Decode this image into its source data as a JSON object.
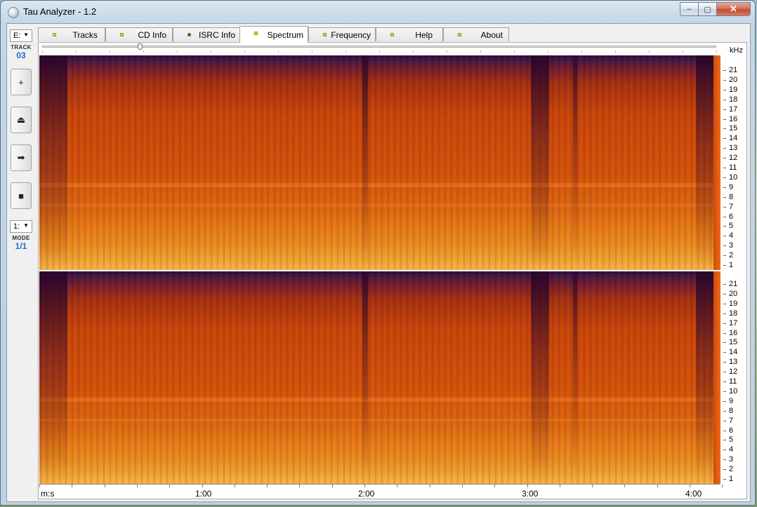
{
  "window": {
    "title": "Tau Analyzer - 1.2",
    "controls": {
      "minimize": "–",
      "maximize": "▢",
      "close": "✕"
    }
  },
  "left_panel": {
    "drive_select": "E:",
    "track_label": "TRACK",
    "track_value": "03",
    "buttons": [
      {
        "name": "add",
        "glyph": "+"
      },
      {
        "name": "eject",
        "glyph": "⏏"
      },
      {
        "name": "play",
        "glyph": "➡"
      },
      {
        "name": "stop",
        "glyph": "■"
      }
    ],
    "mode_select": "1:",
    "mode_label": "MODE",
    "mode_value": "1/1"
  },
  "tabs": [
    {
      "label": "Tracks",
      "active": false,
      "led": "#c8e000"
    },
    {
      "label": "CD Info",
      "active": false,
      "led": "#c8e000"
    },
    {
      "label": "ISRC Info",
      "active": false,
      "led": "#555555"
    },
    {
      "label": "Spectrum",
      "active": true,
      "led": "#c8e000"
    },
    {
      "label": "Frequency",
      "active": false,
      "led": "#c8e000"
    },
    {
      "label": "Help",
      "active": false,
      "led": "#c8e000"
    },
    {
      "label": "About",
      "active": false,
      "led": "#c8e000"
    }
  ],
  "spectrum": {
    "frequency_unit": "kHz",
    "frequency_ticks": [
      "21",
      "20",
      "19",
      "18",
      "17",
      "16",
      "15",
      "14",
      "13",
      "12",
      "11",
      "10",
      "9",
      "8",
      "7",
      "6",
      "5",
      "4",
      "3",
      "2",
      "1"
    ],
    "time_unit_label": "m:s",
    "time_labels": [
      "1:00",
      "2:00",
      "3:00",
      "4:00"
    ],
    "slider_position": 0.145,
    "colors": {
      "low": "#2a0f3e",
      "mid": "#c94509",
      "high": "#f4b545"
    }
  }
}
